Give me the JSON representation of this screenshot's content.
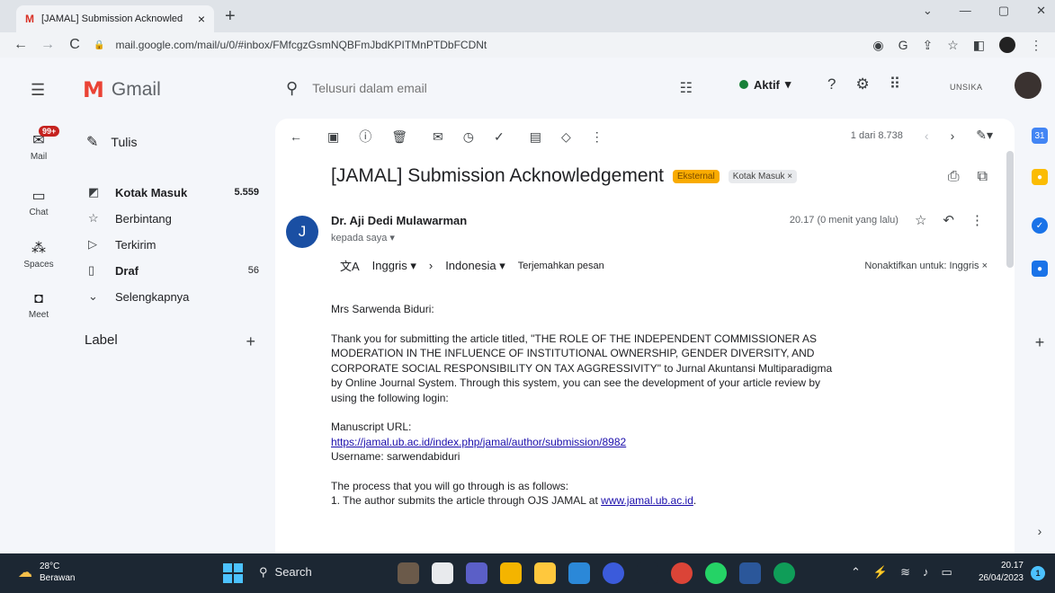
{
  "browser": {
    "tab_title": "[JAMAL] Submission Acknowled",
    "url": "mail.google.com/mail/u/0/#inbox/FMfcgzGsmNQBFmJbdKPITMnPTDbFCDNt"
  },
  "gmail": {
    "product_name": "Gmail",
    "search_placeholder": "Telusuri dalam email",
    "status": "Aktif",
    "org_label": "UNSIKA"
  },
  "rail": {
    "mail_badge": "99+",
    "items": [
      {
        "label": "Mail"
      },
      {
        "label": "Chat"
      },
      {
        "label": "Spaces"
      },
      {
        "label": "Meet"
      }
    ]
  },
  "sidebar": {
    "compose_label": "Tulis",
    "items": [
      {
        "label": "Kotak Masuk",
        "count": "5.559"
      },
      {
        "label": "Berbintang",
        "count": ""
      },
      {
        "label": "Terkirim",
        "count": ""
      },
      {
        "label": "Draf",
        "count": "56"
      },
      {
        "label": "Selengkapnya",
        "count": ""
      }
    ],
    "labels_heading": "Label"
  },
  "toolbar": {
    "pager_text": "1 dari 8.738"
  },
  "message": {
    "subject": "[JAMAL] Submission Acknowledgement",
    "chip_external": "Eksternal",
    "chip_inbox": "Kotak Masuk ×",
    "sender_initial": "J",
    "sender_name": "Dr. Aji Dedi Mulawarman",
    "recipient": "kepada saya ▾",
    "time": "20.17 (0 menit yang lalu)",
    "translate": {
      "from_lang": "Inggris",
      "to_lang": "Indonesia",
      "translate_link": "Terjemahkan pesan",
      "disable": "Nonaktifkan untuk: Inggris ×"
    },
    "greeting": "Mrs Sarwenda Biduri:",
    "paragraph1": "Thank you for submitting the article titled, \"THE ROLE OF THE INDEPENDENT COMMISSIONER AS MODERATION IN THE INFLUENCE OF INSTITUTIONAL OWNERSHIP, GENDER DIVERSITY, AND CORPORATE SOCIAL RESPONSIBILITY ON TAX AGGRESSIVITY\" to Jurnal Akuntansi Multiparadigma by Online Journal System. Through this system, you can see the development of your article review by using the following login:",
    "manuscript_label": "Manuscript URL:",
    "manuscript_url": "https://jamal.ub.ac.id/index.php/jamal/author/submission/8982",
    "username": "Username: sarwendabiduri",
    "process_intro": "The process that you will go through is as follows:",
    "step1_text": "1. The author submits the article through OJS JAMAL at ",
    "step1_link": "www.jamal.ub.ac.id",
    "step1_end": "."
  },
  "taskbar": {
    "temperature": "28°C",
    "weather": "Berawan",
    "search_label": "Search",
    "time": "20.17",
    "date": "26/04/2023",
    "notifications": "1"
  }
}
